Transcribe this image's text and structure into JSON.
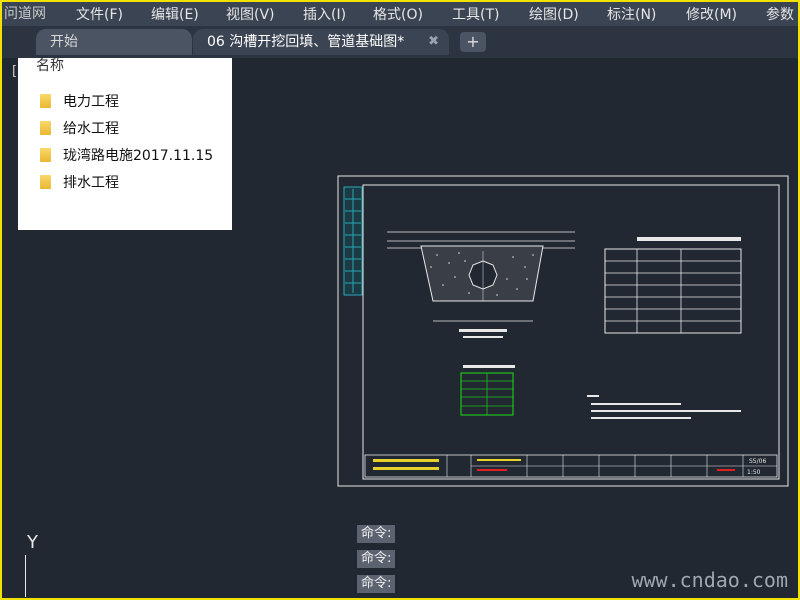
{
  "app": {
    "logo_text": "问道网"
  },
  "menu": [
    "文件(F)",
    "编辑(E)",
    "视图(V)",
    "插入(I)",
    "格式(O)",
    "工具(T)",
    "绘图(D)",
    "标注(N)",
    "修改(M)",
    "参数"
  ],
  "tabs": [
    {
      "label": "开始",
      "active": false
    },
    {
      "label": "06 沟槽开挖回填、管道基础图*",
      "active": true
    }
  ],
  "tab_close_icon": "close-icon",
  "tab_add_icon": "plus-icon",
  "file_panel": {
    "header": "名称",
    "items": [
      "电力工程",
      "给水工程",
      "珑湾路电施2017.11.15",
      "排水工程"
    ]
  },
  "command_lines": [
    "命令:",
    "命令:",
    "命令:"
  ],
  "ucs_label": "Y",
  "watermark": "www.cndao.com",
  "drawing": {
    "scale_label": "1:50",
    "drawing_no": "S5/06"
  },
  "colors": {
    "background": "#212832",
    "menubar": "#3b4453",
    "frame": "#f2e200",
    "drawing_lines": "#e8e8e8",
    "accent_green": "#1ec01e",
    "accent_red": "#e02020",
    "accent_yellow": "#e6d22a",
    "accent_cyan": "#2aa7b6"
  }
}
